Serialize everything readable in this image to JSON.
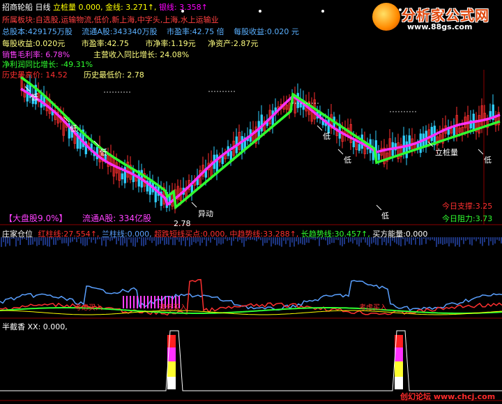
{
  "header": {
    "stock_name": "招商轮船",
    "period": "日线",
    "indicators": [
      {
        "label": "立桩量",
        "value": "0.000,",
        "color": "#ffff00"
      },
      {
        "label": "金线:",
        "value": "3.271↑,",
        "color": "#ffff00"
      },
      {
        "label": "银线:",
        "value": "3.358↑",
        "color": "#ff00ff"
      }
    ]
  },
  "sector_line": "所属板块:自选股,运输物流,低价,新上海,中字头,上海,水上运输业",
  "fundamentals": {
    "row1": [
      {
        "label": "总股本:",
        "value": "429175万股"
      },
      {
        "label": "流通A股:",
        "value": "343340万股"
      },
      {
        "label": "市盈率:",
        "value": "42.75 倍"
      },
      {
        "label": "每股收益:",
        "value": "0.020 元"
      }
    ],
    "row2": [
      {
        "label": "每股收益:",
        "value": "0.020元"
      },
      {
        "label": "市盈率:",
        "value": "42.75"
      },
      {
        "label": "市净率:",
        "value": "1.19元"
      },
      {
        "label": "净资产:",
        "value": "2.87元"
      }
    ],
    "row3_a": "销售毛利率: 6.78%",
    "row3_b": "主营收入同比增长: 24.08%",
    "row4": "净利润同比增长: -49.31%",
    "row5_a": "历史最高价: 14.52",
    "row5_b": "历史最低价: 2.78"
  },
  "main_chart": {
    "annotations": {
      "low_labels": [
        "低",
        "低",
        "低",
        "低",
        "低",
        "低",
        "低"
      ],
      "yidong": "异动",
      "lizhuangliang": "立桩量",
      "low_price": "2.78"
    },
    "bottom_left": "【大盘股9.0%】",
    "bottom_mid": "流通A股:",
    "bottom_mid_value": "334亿股",
    "support": {
      "label": "今日支撑:",
      "value": "3.25"
    },
    "resistance": {
      "label": "今日阻力:",
      "value": "3.73"
    }
  },
  "panel2": {
    "title": "庄家仓位",
    "items": [
      {
        "label": "红柱线:",
        "value": "27.554↑,",
        "color": "#ff3030"
      },
      {
        "label": "兰柱线:",
        "value": "0.000,",
        "color": "#5aa0ff"
      },
      {
        "label": "超跌短线买点:",
        "value": "0.000,",
        "color": "#ff3030"
      },
      {
        "label": "中趋势线:",
        "value": "33.288↑,",
        "color": "#ff3030"
      },
      {
        "label": "长趋势线:",
        "value": "30.457↑,",
        "color": "#00ff00"
      },
      {
        "label": "买方能量:",
        "value": "0.000",
        "color": "#ffffff"
      }
    ],
    "buy_labels": [
      "考虑买入",
      "逢低买入",
      "考虑买入"
    ]
  },
  "panel3": {
    "title": "半截香",
    "value": "XX: 0.000,"
  },
  "watermark": {
    "title": "分析家公式网",
    "url": "www.88gs.com",
    "footer": "创幻论坛 www.chcj.com"
  },
  "colors": {
    "up": "#ff3030",
    "down": "#30d0ff",
    "magenta_line": "#ff30ff",
    "green_line": "#30ff30",
    "background": "#000000"
  }
}
